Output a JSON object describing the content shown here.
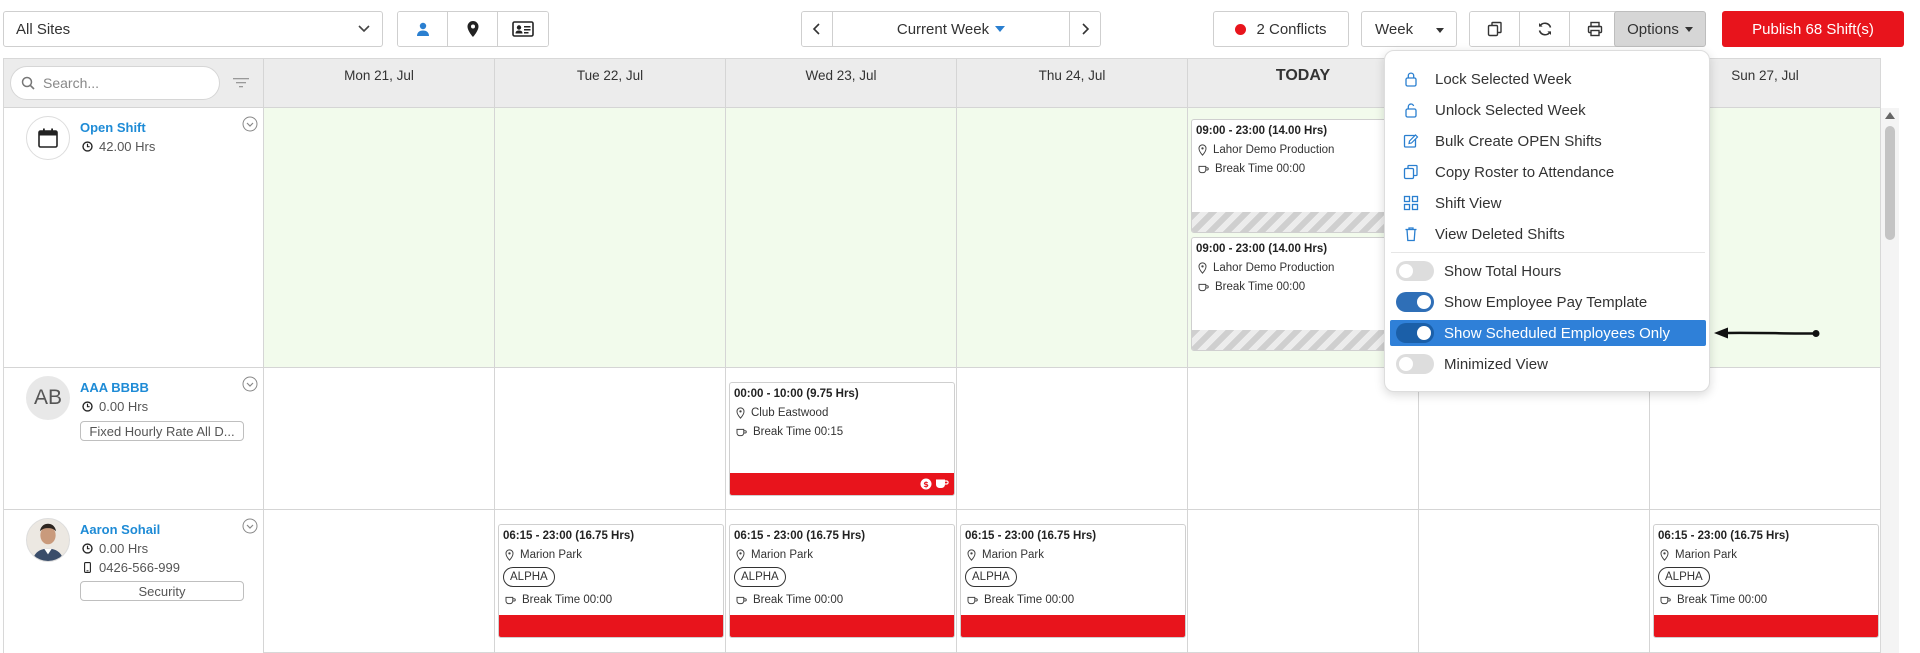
{
  "toolbar": {
    "site_select": "All Sites",
    "week_nav": {
      "label": "Current Week"
    },
    "conflicts": "2 Conflicts",
    "view_select": "Week",
    "options_label": "Options",
    "publish_label": "Publish 68 Shift(s)",
    "status_colors": {
      "publish": "#e8141c",
      "conflict_dot": "#e8141c",
      "accent": "#2f80d8"
    }
  },
  "grid": {
    "search_placeholder": "Search...",
    "days": [
      "Mon 21, Jul",
      "Tue 22, Jul",
      "Wed 23, Jul",
      "Thu 24, Jul",
      "TODAY",
      "",
      "Sun 27, Jul"
    ],
    "rows": [
      {
        "name": "Open Shift",
        "hours": "42.00 Hrs",
        "shifts": [
          {
            "time": "09:00 - 23:00 (14.00 Hrs)",
            "location": "Lahor Demo Production",
            "break": "Break Time 00:00"
          },
          {
            "time": "09:00 - 23:00 (14.00 Hrs)",
            "location": "Lahor Demo Production",
            "break": "Break Time 00:00"
          }
        ]
      },
      {
        "initials": "AB",
        "name": "AAA BBBB",
        "hours": "0.00 Hrs",
        "tag": "Fixed Hourly Rate All D...",
        "shifts": [
          {
            "time": "00:00 - 10:00 (9.75 Hrs)",
            "location": "Club Eastwood",
            "break": "Break Time 00:15"
          }
        ]
      },
      {
        "name": "Aaron Sohail",
        "hours": "0.00 Hrs",
        "phone": "0426-566-999",
        "tag": "Security",
        "shifts": [
          {
            "time": "06:15 - 23:00 (16.75 Hrs)",
            "location": "Marion Park",
            "pill": "ALPHA",
            "break": "Break Time 00:00"
          },
          {
            "time": "06:15 - 23:00 (16.75 Hrs)",
            "location": "Marion Park",
            "pill": "ALPHA",
            "break": "Break Time 00:00"
          },
          {
            "time": "06:15 - 23:00 (16.75 Hrs)",
            "location": "Marion Park",
            "pill": "ALPHA",
            "break": "Break Time 00:00"
          },
          {
            "time": "06:15 - 23:00 (16.75 Hrs)",
            "location": "Marion Park",
            "pill": "ALPHA",
            "break": "Break Time 00:00"
          }
        ]
      }
    ]
  },
  "options_menu": {
    "actions": [
      {
        "label": "Lock Selected Week",
        "icon": "lock-icon"
      },
      {
        "label": "Unlock Selected Week",
        "icon": "unlock-icon"
      },
      {
        "label": "Bulk Create OPEN Shifts",
        "icon": "edit-icon"
      },
      {
        "label": "Copy Roster to Attendance",
        "icon": "copy-icon"
      },
      {
        "label": "Shift View",
        "icon": "grid-icon"
      },
      {
        "label": "View Deleted Shifts",
        "icon": "trash-icon"
      }
    ],
    "toggles": [
      {
        "label": "Show Total Hours",
        "on": false
      },
      {
        "label": "Show Employee Pay Template",
        "on": true
      },
      {
        "label": "Show Scheduled Employees Only",
        "on": true,
        "highlighted": true
      },
      {
        "label": "Minimized View",
        "on": false
      }
    ]
  }
}
